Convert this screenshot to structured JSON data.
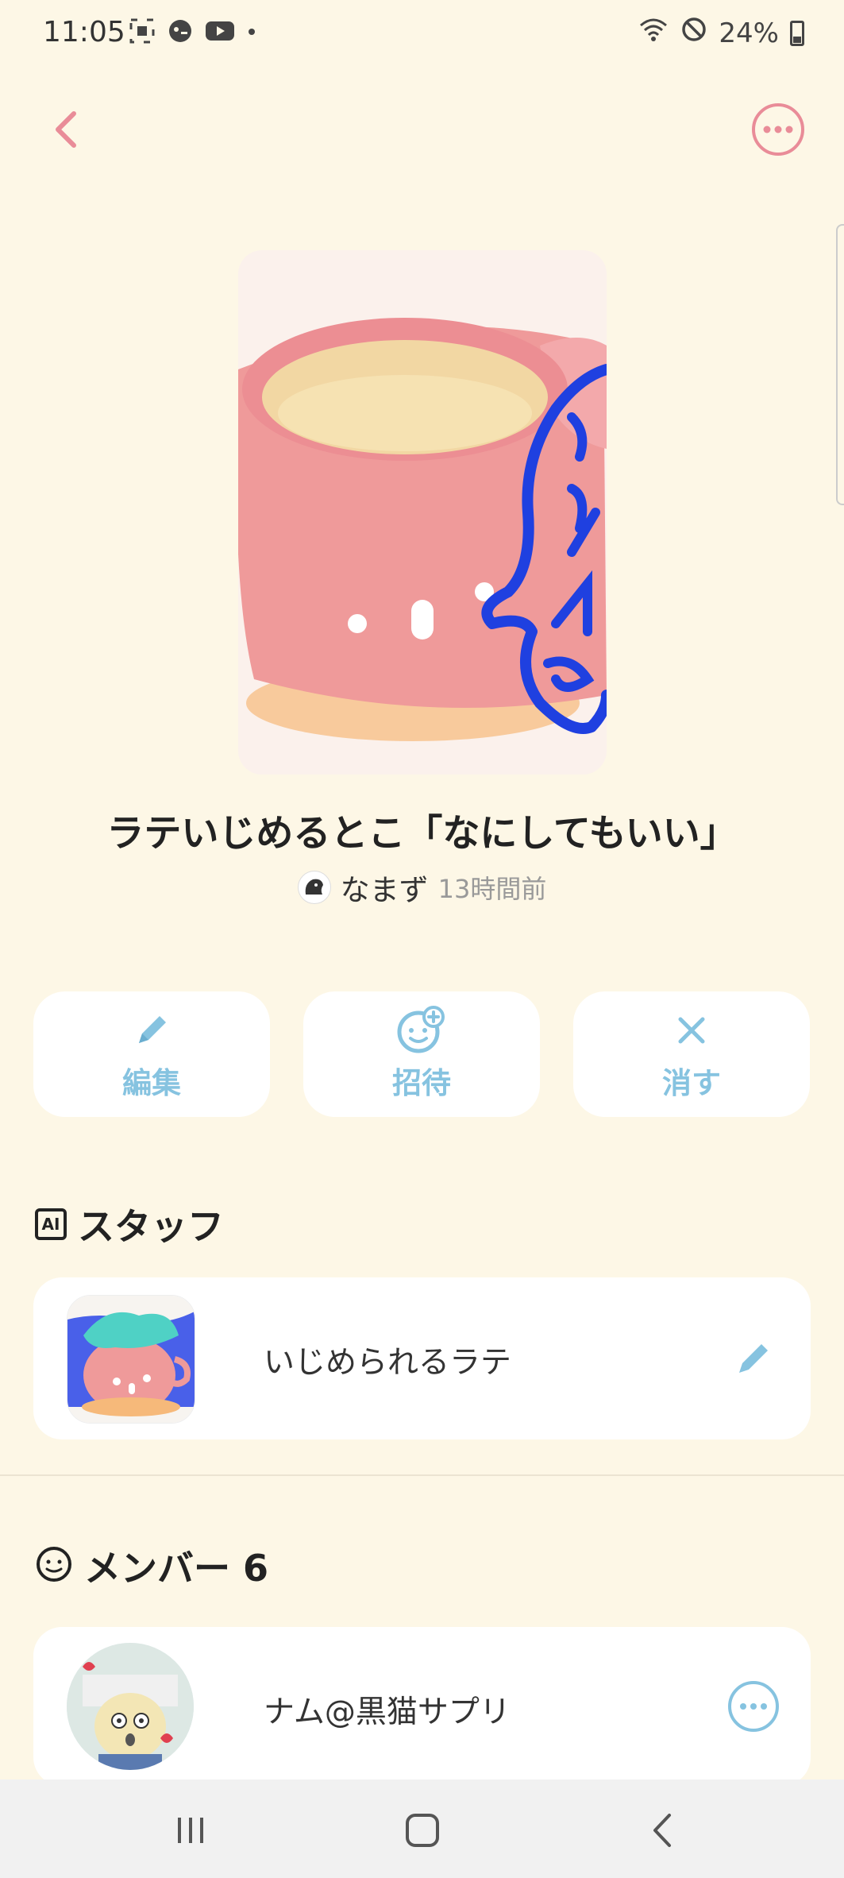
{
  "status_bar": {
    "time": "11:05",
    "battery": "24%",
    "icons": [
      "screenshot-icon",
      "gamepad-icon",
      "youtube-icon",
      "dot-icon",
      "wifi-icon",
      "dnd-icon",
      "battery-icon"
    ]
  },
  "header": {
    "back_icon": "chevron-left-icon",
    "more_icon": "more-horizontal-icon",
    "accent": "#e98c98"
  },
  "room": {
    "title": "ラテいじめるとこ「なにしてもいい」",
    "author": "なまず",
    "time_ago": "13時間前"
  },
  "actions": [
    {
      "label": "編集",
      "icon": "pencil-icon"
    },
    {
      "label": "招待",
      "icon": "invite-icon"
    },
    {
      "label": "消す",
      "icon": "close-icon"
    }
  ],
  "staff": {
    "title": "スタッフ",
    "badge": "AI",
    "items": [
      {
        "name": "いじめられるラテ",
        "action_icon": "pencil-icon"
      }
    ]
  },
  "members": {
    "title": "メンバー 6",
    "items": [
      {
        "name": "ナム@黒猫サプリ",
        "action_icon": "more-horizontal-icon"
      }
    ]
  },
  "nav": {
    "icons": [
      "recents-icon",
      "home-icon",
      "back-icon"
    ]
  },
  "colors": {
    "background": "#fdf7e6",
    "action_blue": "#86c3e0",
    "accent_pink": "#e98c98"
  }
}
